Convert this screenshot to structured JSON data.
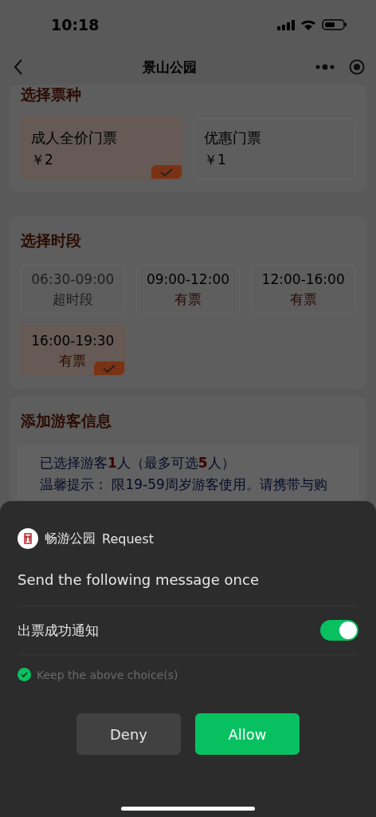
{
  "status_bar": {
    "time": "10:18"
  },
  "nav": {
    "title": "景山公园"
  },
  "ticket_section": {
    "title": "选择票种",
    "tickets": [
      {
        "name": "成人全价门票",
        "price": "￥2",
        "selected": true
      },
      {
        "name": "优惠门票",
        "price": "￥1",
        "selected": false
      }
    ]
  },
  "time_section": {
    "title": "选择时段",
    "slots": [
      {
        "time": "06:30-09:00",
        "status": "超时段",
        "disabled": true,
        "selected": false
      },
      {
        "time": "09:00-12:00",
        "status": "有票",
        "disabled": false,
        "selected": false
      },
      {
        "time": "12:00-16:00",
        "status": "有票",
        "disabled": false,
        "selected": false
      },
      {
        "time": "16:00-19:30",
        "status": "有票",
        "disabled": false,
        "selected": true
      }
    ]
  },
  "visitor_section": {
    "title": "添加游客信息",
    "summary": "已选择游客**1**人（最多可选**5**人）",
    "hint": "温馨提示： 限19-59周岁游客使用。请携带与购"
  },
  "sheet": {
    "app_name": "畅游公园",
    "request_label": "Request",
    "message": "Send the following message once",
    "options": [
      {
        "label": "出票成功通知",
        "on": true
      }
    ],
    "keep_choice": {
      "label": "Keep the above choice(s)",
      "checked": true
    },
    "buttons": [
      {
        "label": "Deny",
        "kind": "secondary"
      },
      {
        "label": "Allow",
        "kind": "primary"
      }
    ]
  }
}
